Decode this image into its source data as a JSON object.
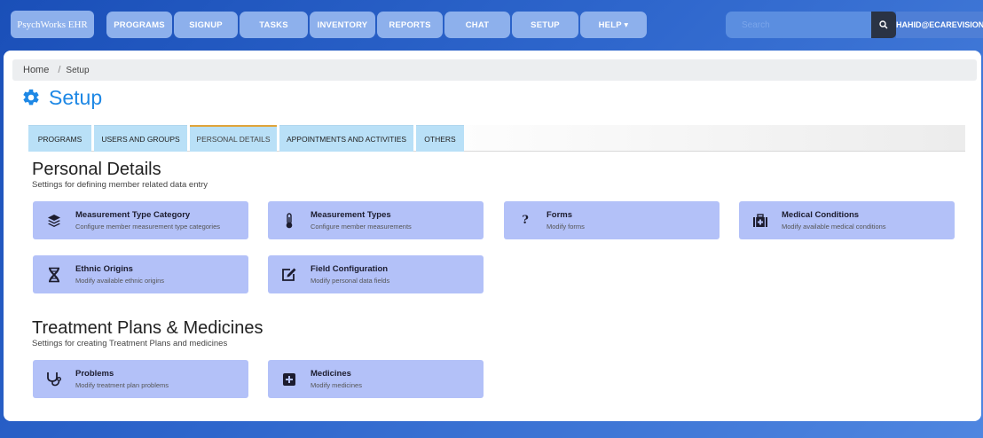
{
  "nav": {
    "brand": "PsychWorks EHR",
    "items": [
      {
        "label": "PROGRAMS"
      },
      {
        "label": "SIGNUP"
      },
      {
        "label": "TASKS"
      },
      {
        "label": "INVENTORY"
      },
      {
        "label": "REPORTS"
      },
      {
        "label": "CHAT"
      },
      {
        "label": "SETUP"
      },
      {
        "label": "HELP ▾"
      }
    ],
    "search_placeholder": "Search",
    "user": "HAHID@ECAREVISIONS"
  },
  "breadcrumb": {
    "home": "Home",
    "separator": "/",
    "current": "Setup"
  },
  "page_title": "Setup",
  "tabs": [
    {
      "label": "PROGRAMS"
    },
    {
      "label": "USERS AND GROUPS"
    },
    {
      "label": "PERSONAL DETAILS"
    },
    {
      "label": "APPOINTMENTS AND ACTIVITIES"
    },
    {
      "label": "OTHERS"
    }
  ],
  "sections": [
    {
      "title": "Personal Details",
      "subtitle": "Settings for defining member related data entry",
      "cards": [
        {
          "title": "Measurement Type Category",
          "desc": "Configure member measurement type categories",
          "icon": "layers-icon"
        },
        {
          "title": "Measurement Types",
          "desc": "Configure member measurements",
          "icon": "thermometer-icon"
        },
        {
          "title": "Forms",
          "desc": "Modify forms",
          "icon": "question-icon"
        },
        {
          "title": "Medical Conditions",
          "desc": "Modify available medical conditions",
          "icon": "medical-kit-icon"
        },
        {
          "title": "Ethnic Origins",
          "desc": "Modify available ethnic origins",
          "icon": "dna-icon"
        },
        {
          "title": "Field Configuration",
          "desc": "Modify personal data fields",
          "icon": "edit-icon"
        }
      ]
    },
    {
      "title": "Treatment Plans & Medicines",
      "subtitle": "Settings for creating Treatment Plans and medicines",
      "cards": [
        {
          "title": "Problems",
          "desc": "Modify treatment plan problems",
          "icon": "stethoscope-icon"
        },
        {
          "title": "Medicines",
          "desc": "Modify medicines",
          "icon": "plus-square-icon"
        }
      ]
    }
  ],
  "colors": {
    "accent": "#1e88e5",
    "card": "#b3c1f8",
    "tab": "#b9e0f7",
    "nav_button": "#8db0ec",
    "active_tab_border": "#e0a43a"
  }
}
